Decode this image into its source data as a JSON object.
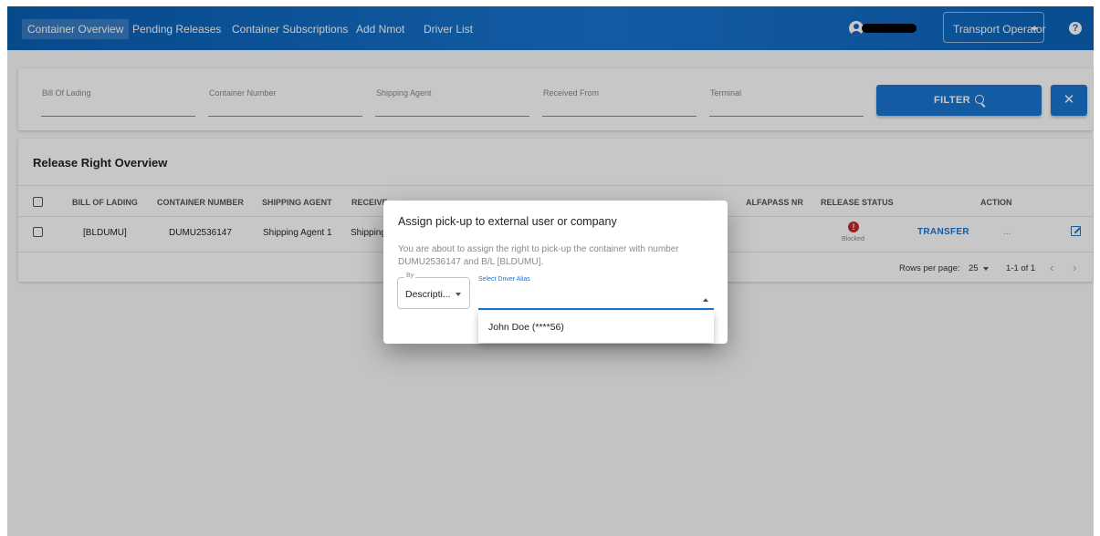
{
  "nav": {
    "items": [
      {
        "label": "Container Overview",
        "active": true
      },
      {
        "label": "Pending Releases",
        "active": false
      },
      {
        "label": "Container Subscriptions",
        "active": false
      },
      {
        "label": "Add Nmot",
        "active": false
      },
      {
        "label": "Driver List",
        "active": false
      }
    ],
    "role": "Transport Operator",
    "help_symbol": "?"
  },
  "filters": {
    "bill_of_lading": "Bill Of Lading",
    "container_number": "Container Number",
    "shipping_agent": "Shipping Agent",
    "received_from": "Received From",
    "terminal": "Terminal",
    "filter_button": "FILTER",
    "clear_symbol": "✕"
  },
  "table": {
    "title": "Release Right Overview",
    "headers": {
      "bill_of_lading": "BILL OF LADING",
      "container_number": "CONTAINER NUMBER",
      "shipping_agent": "SHIPPING AGENT",
      "received_from": "RECEIVE",
      "alfapass": "ALFAPASS NR",
      "release_status": "RELEASE STATUS",
      "action": "ACTION"
    },
    "row": {
      "bill_of_lading": "[BLDUMU]",
      "container_number": "DUMU2536147",
      "shipping_agent": "Shipping Agent 1",
      "received_from": "Shipping",
      "status_symbol": "!",
      "status": "Blocked",
      "transfer": "TRANSFER",
      "more": "...",
      "open_icon": "open-in-new"
    },
    "pagination": {
      "rows_per_page_label": "Rows per page:",
      "rows_per_page": "25",
      "range": "1-1 of 1",
      "prev": "‹",
      "next": "›"
    }
  },
  "dialog": {
    "title": "Assign pick-up to external user or company",
    "text": "You are about to assign the right to pick-up the container with number DUMU2536147 and B/L [BLDUMU].",
    "by_label": "By",
    "by_value": "Descripti...",
    "alias_label": "Select Driver Alias",
    "options": [
      "John Doe (****56)"
    ]
  }
}
